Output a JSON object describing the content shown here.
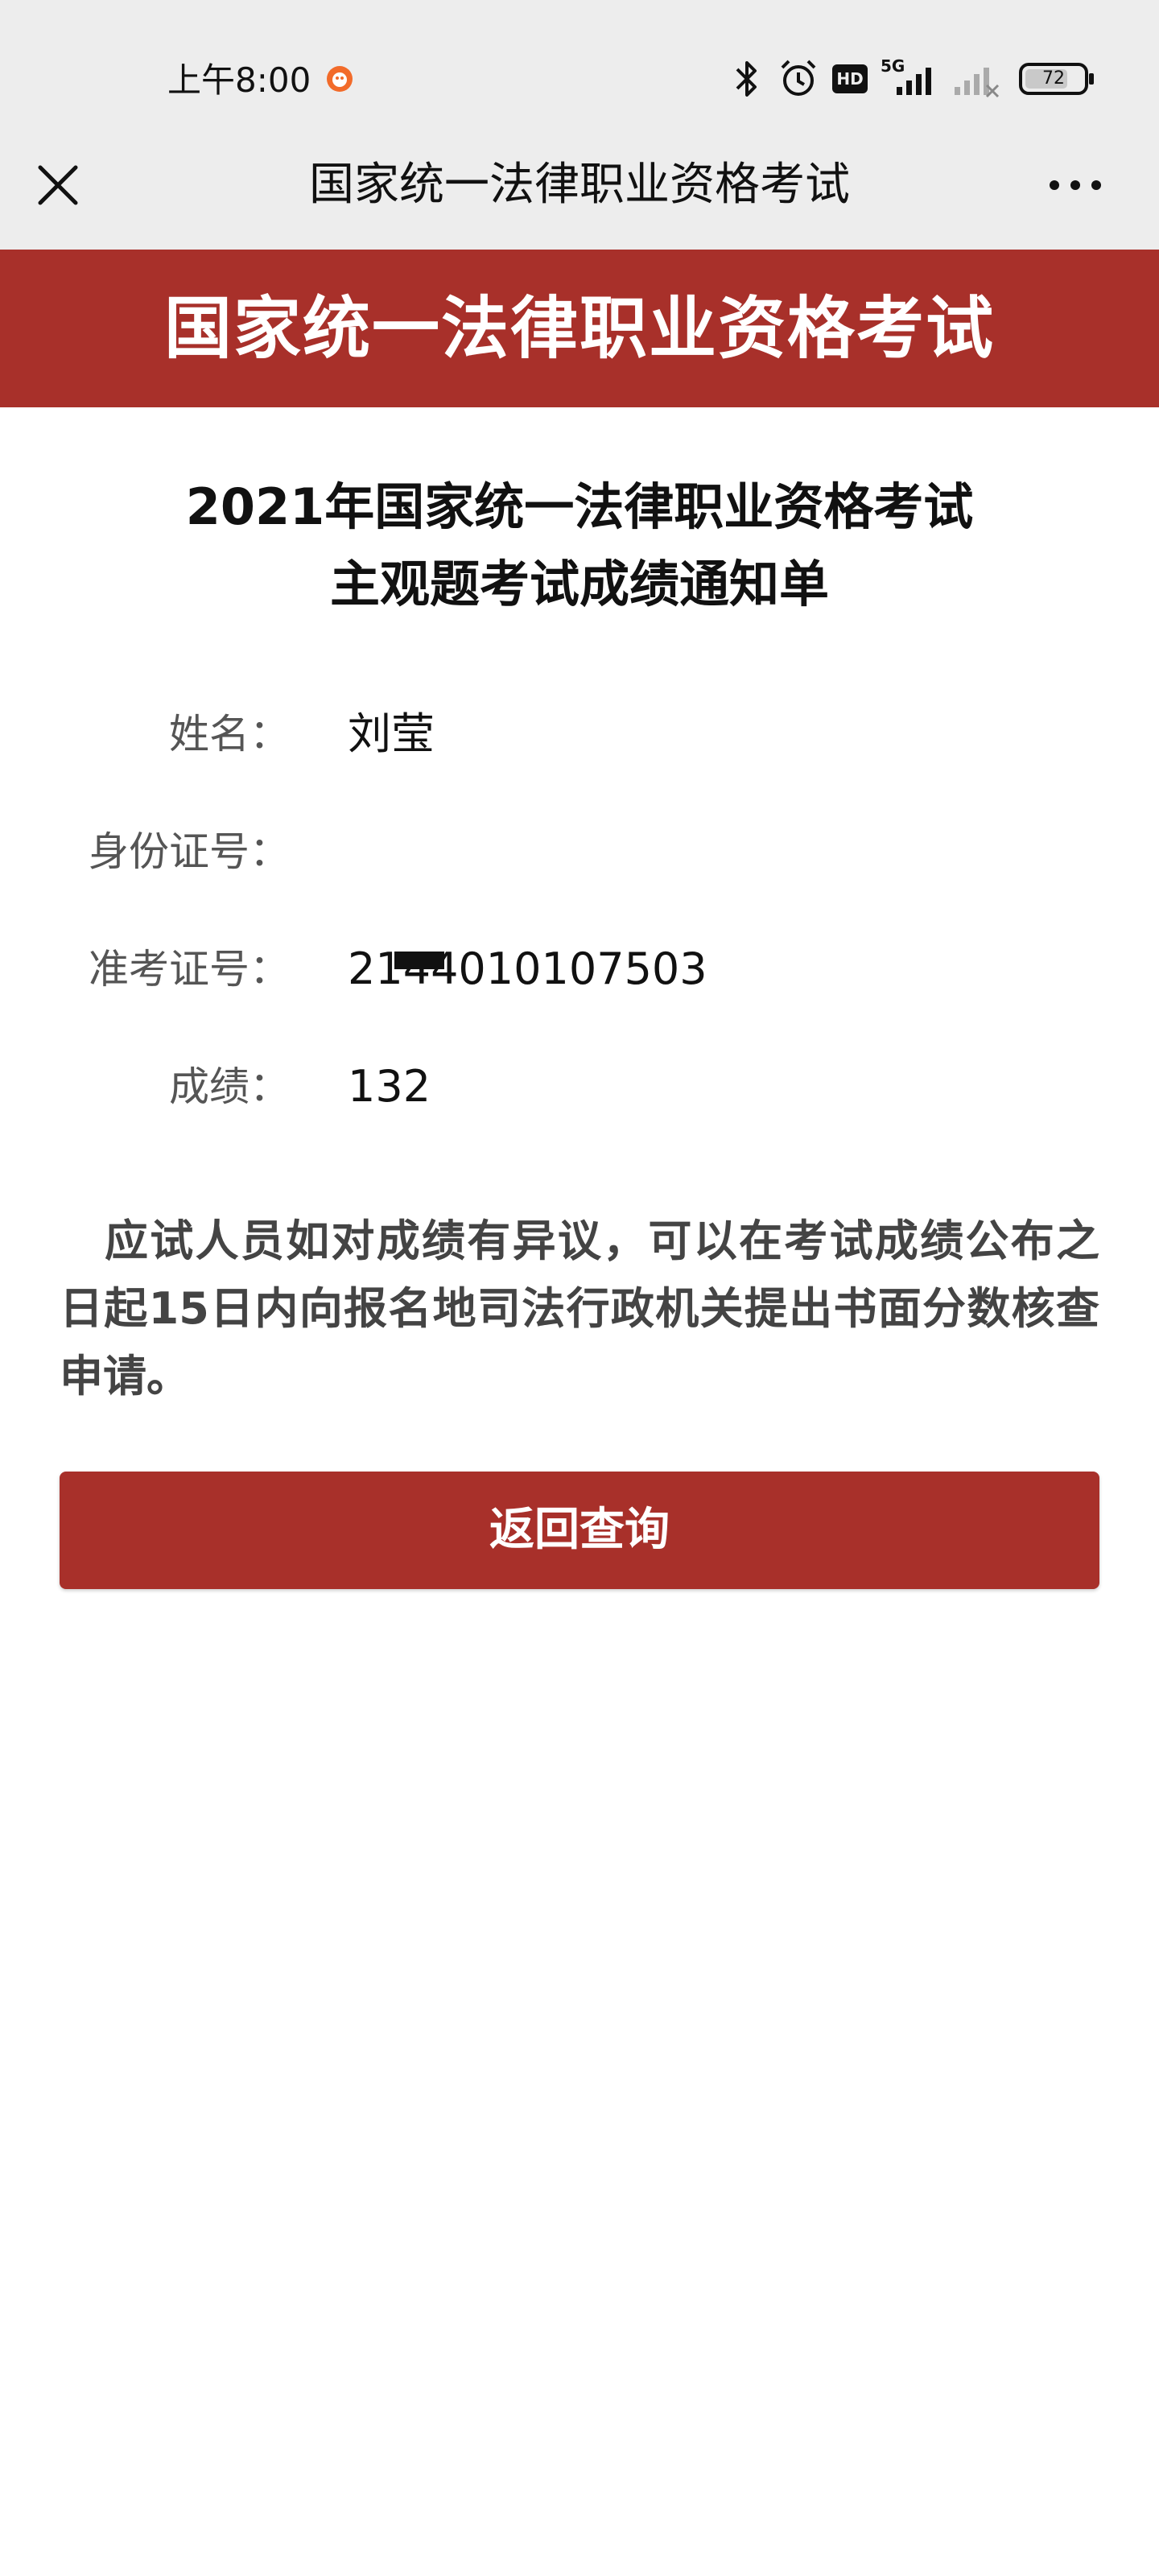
{
  "status_bar": {
    "time": "上午8:00",
    "network": "5G",
    "hd": "HD",
    "battery": "72"
  },
  "nav": {
    "title": "国家统一法律职业资格考试"
  },
  "banner": {
    "title": "国家统一法律职业资格考试"
  },
  "headline": {
    "line1": "2021年国家统一法律职业资格考试",
    "line2": "主观题考试成绩通知单"
  },
  "info": [
    {
      "label": "姓名：",
      "value": "刘莹"
    },
    {
      "label": "身份证号：",
      "value": ""
    },
    {
      "label": "准考证号：",
      "value": "2144010107503"
    },
    {
      "label": "成绩：",
      "value": "132"
    }
  ],
  "notice": "应试人员如对成绩有异议，可以在考试成绩公布之日起15日内向报名地司法行政机关提出书面分数核查申请。",
  "button": {
    "label": "返回查询"
  },
  "colors": {
    "accent": "#a8302a",
    "chrome": "#ededed"
  }
}
